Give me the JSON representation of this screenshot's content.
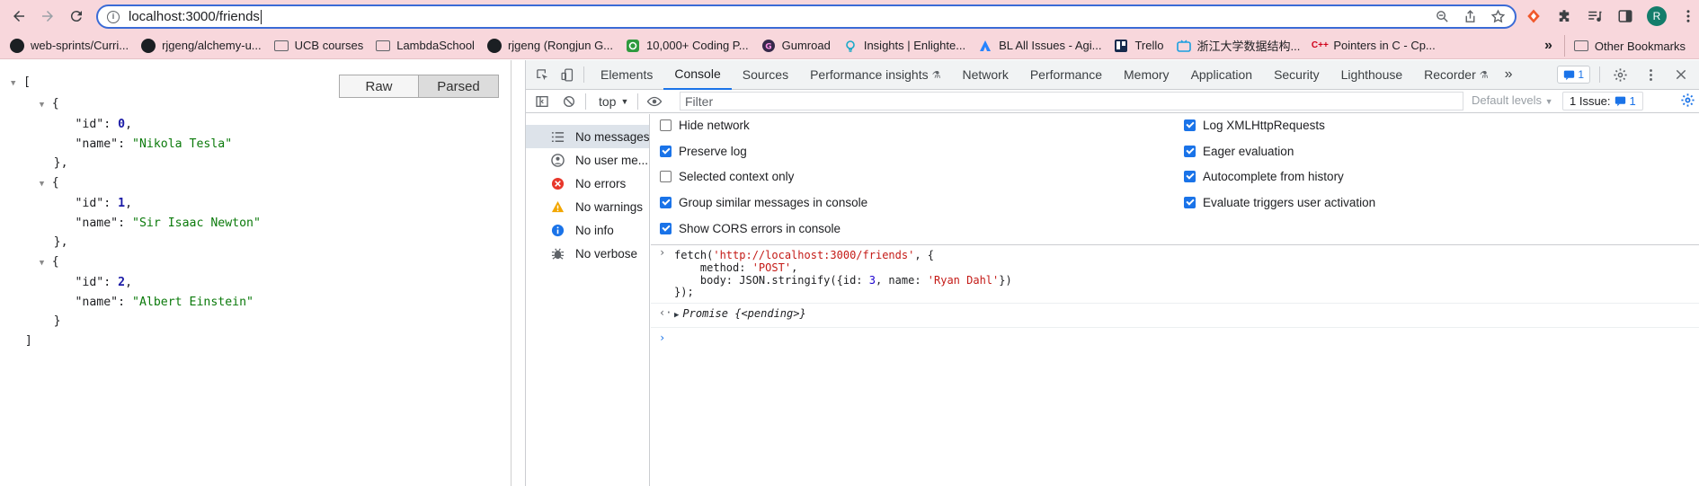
{
  "browser": {
    "url": "localhost:3000/friends",
    "profile_initial": "R"
  },
  "bookmarks": [
    {
      "label": "web-sprints/Curri...",
      "icon": "github-icon"
    },
    {
      "label": "rjgeng/alchemy-u...",
      "icon": "github-icon"
    },
    {
      "label": "UCB courses",
      "icon": "folder-icon"
    },
    {
      "label": "LambdaSchool",
      "icon": "folder-icon"
    },
    {
      "label": "rjgeng (Rongjun G...",
      "icon": "github-icon"
    },
    {
      "label": "10,000+ Coding P...",
      "icon": "coding-icon"
    },
    {
      "label": "Gumroad",
      "icon": "gumroad-icon"
    },
    {
      "label": "Insights | Enlighte...",
      "icon": "bulb-icon"
    },
    {
      "label": "BL All Issues - Agi...",
      "icon": "jira-icon"
    },
    {
      "label": "Trello",
      "icon": "trello-icon"
    },
    {
      "label": "浙江大学数据结构...",
      "icon": "bilibili-icon"
    },
    {
      "label": "Pointers in C - Cp...",
      "icon": "cpp-icon"
    }
  ],
  "bookmarks_overflow": "»",
  "other_bookmarks": "Other Bookmarks",
  "viewer": {
    "raw_label": "Raw",
    "parsed_label": "Parsed",
    "open_bracket": "[",
    "close_bracket": "]",
    "items": [
      {
        "id": "0",
        "name": "\"Nikola Tesla\""
      },
      {
        "id": "1",
        "name": "\"Sir Isaac Newton\""
      },
      {
        "id": "2",
        "name": "\"Albert Einstein\""
      }
    ]
  },
  "devtools": {
    "tabs": [
      "Elements",
      "Console",
      "Sources",
      "Performance insights",
      "Network",
      "Performance",
      "Memory",
      "Application",
      "Security",
      "Lighthouse",
      "Recorder"
    ],
    "active_tab": "Console",
    "issue_count": "1",
    "context": "top",
    "filter_placeholder": "Filter",
    "levels": "Default levels",
    "issues_label": "1 Issue:",
    "issues_count": "1",
    "sidebar": [
      {
        "label": "No messages",
        "icon": "list-icon"
      },
      {
        "label": "No user me...",
        "icon": "user-icon"
      },
      {
        "label": "No errors",
        "icon": "error-icon"
      },
      {
        "label": "No warnings",
        "icon": "warning-icon"
      },
      {
        "label": "No info",
        "icon": "info-icon"
      },
      {
        "label": "No verbose",
        "icon": "bug-icon"
      }
    ],
    "settings_left": [
      {
        "label": "Hide network",
        "checked": false
      },
      {
        "label": "Preserve log",
        "checked": true
      },
      {
        "label": "Selected context only",
        "checked": false
      },
      {
        "label": "Group similar messages in console",
        "checked": true
      },
      {
        "label": "Show CORS errors in console",
        "checked": true
      }
    ],
    "settings_right": [
      {
        "label": "Log XMLHttpRequests",
        "checked": true
      },
      {
        "label": "Eager evaluation",
        "checked": true
      },
      {
        "label": "Autocomplete from history",
        "checked": true
      },
      {
        "label": "Evaluate triggers user activation",
        "checked": true
      }
    ],
    "console": {
      "code_line1_a": "fetch(",
      "code_line1_url": "'http://localhost:3000/friends'",
      "code_line1_b": ", {",
      "code_line2_a": "    method: ",
      "code_line2_val": "'POST'",
      "code_line2_b": ",",
      "code_line3_a": "    body: JSON.stringify({id: ",
      "code_line3_num": "3",
      "code_line3_b": ", name: ",
      "code_line3_str": "'Ryan Dahl'",
      "code_line3_c": "})",
      "code_line4": "});",
      "result": "Promise {<pending>}"
    }
  }
}
